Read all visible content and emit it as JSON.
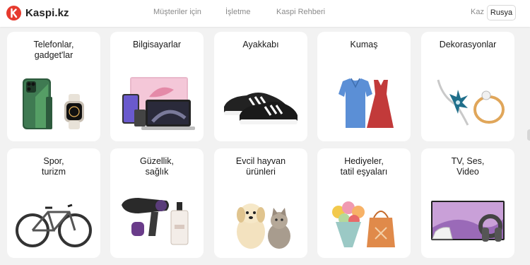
{
  "header": {
    "logo_text": "Kaspi.kz",
    "nav": [
      "Müşteriler için",
      "İşletme",
      "Kaspi Rehberi"
    ],
    "lang_kaz": "Kaz",
    "lang_rus": "Rusya"
  },
  "categories": [
    {
      "title": "Telefonlar,\ngadget'lar"
    },
    {
      "title": "Bilgisayarlar"
    },
    {
      "title": "Ayakkabı"
    },
    {
      "title": "Kumaş"
    },
    {
      "title": "Dekorasyonlar"
    },
    {
      "title": "Spor,\nturizm"
    },
    {
      "title": "Güzellik,\nsağlık"
    },
    {
      "title": "Evcil hayvan\nürünleri"
    },
    {
      "title": "Hediyeler,\ntatil eşyaları"
    },
    {
      "title": "TV, Ses,\nVideo"
    }
  ],
  "colors": {
    "brand": "#e63a2e",
    "background": "#f2f2f2"
  }
}
